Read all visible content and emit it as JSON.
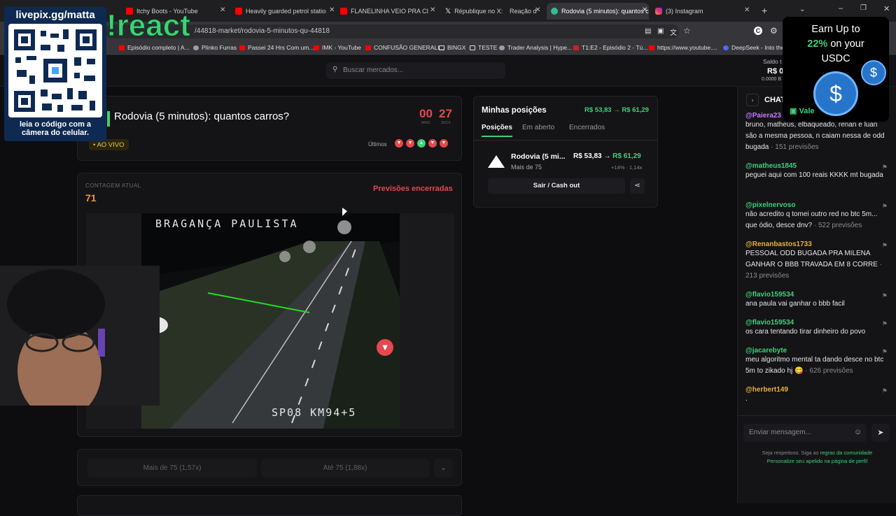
{
  "browser": {
    "tabs": [
      {
        "label": "Itchy Boots - YouTube",
        "color": "#ff0000"
      },
      {
        "label": "Heavily guarded petrol stations",
        "color": "#ff0000"
      },
      {
        "label": "FLANELINHA VEIO PRA CIMA, D",
        "color": "#ff0000"
      },
      {
        "label": "République no X: \"",
        "color": "#ffffff"
      },
      {
        "label": "Reação d",
        "color": "#888888"
      },
      {
        "label": "Rodovia (5 minutos): quantos ca",
        "color": "#2fbf8f"
      },
      {
        "label": "(3) Instagram",
        "color": "#e1306c"
      }
    ],
    "url": "/44818-market/rodovia-5-minutos-qu-44818",
    "bookmarks": [
      "Episódio completo | A...",
      "Plinko Furras",
      "Passei 24 Hrs Com um...",
      "IMK - YouTube",
      "CONFUSÃO GENERALI...",
      "BINGX",
      "TESTE",
      "Trader Analysis | Hype...",
      "T1:E2 - Episódio 2 - Tú...",
      "https://www.youtube....",
      "DeepSeek - Into the ..."
    ]
  },
  "header": {
    "search_placeholder": "Buscar mercados...",
    "balance_label": "Saldo t",
    "balance_value": "R$ 0",
    "balance_sub": "0.0000 B"
  },
  "market": {
    "title": "Rodovia (5 minutos): quantos carros?",
    "timer_min": "00",
    "timer_sec": "27",
    "timer_min_label": "MINS",
    "timer_sec_label": "SECS",
    "live_label": "• AO VIVO",
    "last_label": "Últimos",
    "last_results": [
      "down",
      "down",
      "up",
      "down",
      "down"
    ]
  },
  "stream": {
    "count_label": "CONTAGEM ATUAL",
    "count_value": "71",
    "status": "Previsões encerradas",
    "cam_title": "BRAGANÇA PAULISTA",
    "cam_location": "SP08 KM94+5"
  },
  "bet_buttons": {
    "more": "Mais de 75 (1,57x)",
    "less": "Até 75 (1,88x)"
  },
  "positions": {
    "title": "Minhas posições",
    "summary_from": "R$ 53,83",
    "summary_to": "R$ 61,29",
    "tabs": [
      "Posições",
      "Em aberto",
      "Encerrados"
    ],
    "item_title": "Rodovia (5 mi...",
    "item_sub": "Mais de 75",
    "item_from": "R$ 53,83",
    "item_to": "R$ 61,29",
    "item_change": "+14% · 1,14x",
    "cashout": "Sair / Cash out"
  },
  "chat": {
    "title": "CHAT",
    "messages": [
      {
        "user": "@Paiera23",
        "text": "bruno, matheus, elbaqueado, renan e luan são a mesma pessoa, n caiam nessa de odd bugada",
        "meta": " · 151 previsões",
        "color": "#c779ff"
      },
      {
        "user": "@matheus1845",
        "text": "peguei aqui com 100 reais KKKK mt bugada",
        "meta": "",
        "color": "#3fd07a"
      },
      {
        "user": "@pixelnervoso",
        "text": "não acredito q tomei outro red no btc 5m... que ódio, desce dnv?",
        "meta": " · 522 previsões",
        "color": "#3fd07a"
      },
      {
        "user": "@Renanbastos1733",
        "text": "PESSOAL ODD BUGADA PRA MILENA GANHAR O BBB TRAVADA EM 8 CORRE",
        "meta": " · 213 previsões",
        "color": "#e6b23a"
      },
      {
        "user": "@flavio159534",
        "text": "ana paula vai ganhar o bbb facil",
        "meta": "",
        "color": "#3fd07a"
      },
      {
        "user": "@flavio159534",
        "text": "os cara tentando tirar dinheiro do povo",
        "meta": "",
        "color": "#3fd07a"
      },
      {
        "user": "@jacarebyte",
        "text": "meu algoritmo mental ta dando desce no btc 5m to zikado hj 😋",
        "meta": " · 626 previsões",
        "color": "#3fd07a"
      },
      {
        "user": "@herbert149",
        "text": ".",
        "meta": "",
        "color": "#e6b23a"
      }
    ],
    "input_placeholder": "Enviar mensagem...",
    "footer_line1_prefix": "Seja respeitoso. Siga as ",
    "footer_line1_link": "regras da comunidade",
    "footer_line2_link": "Personalize seu apelido na página de perfil"
  },
  "overlay": {
    "qr_title": "livepix.gg/matta",
    "qr_caption_line1": "leia o código com a",
    "qr_caption_line2": "câmera do celular.",
    "react_text": "!react",
    "ad_line1": "Earn Up to",
    "ad_pct": "22%",
    "ad_line2": " on your",
    "ad_line3": "USDC",
    "ad_footer": "Vale"
  },
  "colors": {
    "green": "#3fd07a",
    "red": "#e5484d",
    "orange": "#f0953a",
    "yellow": "#f2c744",
    "bg": "#0d0d0f"
  }
}
